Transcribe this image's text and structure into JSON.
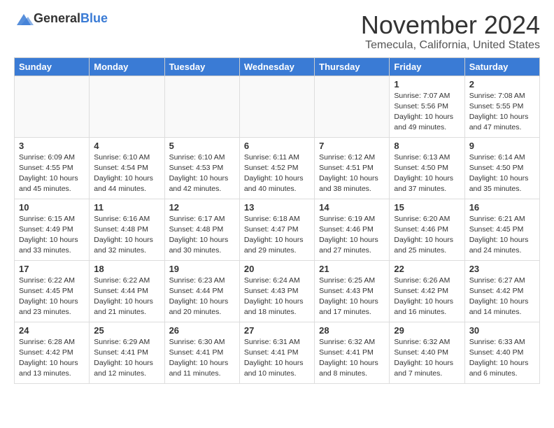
{
  "logo": {
    "general": "General",
    "blue": "Blue"
  },
  "header": {
    "month": "November 2024",
    "location": "Temecula, California, United States"
  },
  "weekdays": [
    "Sunday",
    "Monday",
    "Tuesday",
    "Wednesday",
    "Thursday",
    "Friday",
    "Saturday"
  ],
  "weeks": [
    [
      {
        "day": "",
        "info": ""
      },
      {
        "day": "",
        "info": ""
      },
      {
        "day": "",
        "info": ""
      },
      {
        "day": "",
        "info": ""
      },
      {
        "day": "",
        "info": ""
      },
      {
        "day": "1",
        "info": "Sunrise: 7:07 AM\nSunset: 5:56 PM\nDaylight: 10 hours and 49 minutes."
      },
      {
        "day": "2",
        "info": "Sunrise: 7:08 AM\nSunset: 5:55 PM\nDaylight: 10 hours and 47 minutes."
      }
    ],
    [
      {
        "day": "3",
        "info": "Sunrise: 6:09 AM\nSunset: 4:55 PM\nDaylight: 10 hours and 45 minutes."
      },
      {
        "day": "4",
        "info": "Sunrise: 6:10 AM\nSunset: 4:54 PM\nDaylight: 10 hours and 44 minutes."
      },
      {
        "day": "5",
        "info": "Sunrise: 6:10 AM\nSunset: 4:53 PM\nDaylight: 10 hours and 42 minutes."
      },
      {
        "day": "6",
        "info": "Sunrise: 6:11 AM\nSunset: 4:52 PM\nDaylight: 10 hours and 40 minutes."
      },
      {
        "day": "7",
        "info": "Sunrise: 6:12 AM\nSunset: 4:51 PM\nDaylight: 10 hours and 38 minutes."
      },
      {
        "day": "8",
        "info": "Sunrise: 6:13 AM\nSunset: 4:50 PM\nDaylight: 10 hours and 37 minutes."
      },
      {
        "day": "9",
        "info": "Sunrise: 6:14 AM\nSunset: 4:50 PM\nDaylight: 10 hours and 35 minutes."
      }
    ],
    [
      {
        "day": "10",
        "info": "Sunrise: 6:15 AM\nSunset: 4:49 PM\nDaylight: 10 hours and 33 minutes."
      },
      {
        "day": "11",
        "info": "Sunrise: 6:16 AM\nSunset: 4:48 PM\nDaylight: 10 hours and 32 minutes."
      },
      {
        "day": "12",
        "info": "Sunrise: 6:17 AM\nSunset: 4:48 PM\nDaylight: 10 hours and 30 minutes."
      },
      {
        "day": "13",
        "info": "Sunrise: 6:18 AM\nSunset: 4:47 PM\nDaylight: 10 hours and 29 minutes."
      },
      {
        "day": "14",
        "info": "Sunrise: 6:19 AM\nSunset: 4:46 PM\nDaylight: 10 hours and 27 minutes."
      },
      {
        "day": "15",
        "info": "Sunrise: 6:20 AM\nSunset: 4:46 PM\nDaylight: 10 hours and 25 minutes."
      },
      {
        "day": "16",
        "info": "Sunrise: 6:21 AM\nSunset: 4:45 PM\nDaylight: 10 hours and 24 minutes."
      }
    ],
    [
      {
        "day": "17",
        "info": "Sunrise: 6:22 AM\nSunset: 4:45 PM\nDaylight: 10 hours and 23 minutes."
      },
      {
        "day": "18",
        "info": "Sunrise: 6:22 AM\nSunset: 4:44 PM\nDaylight: 10 hours and 21 minutes."
      },
      {
        "day": "19",
        "info": "Sunrise: 6:23 AM\nSunset: 4:44 PM\nDaylight: 10 hours and 20 minutes."
      },
      {
        "day": "20",
        "info": "Sunrise: 6:24 AM\nSunset: 4:43 PM\nDaylight: 10 hours and 18 minutes."
      },
      {
        "day": "21",
        "info": "Sunrise: 6:25 AM\nSunset: 4:43 PM\nDaylight: 10 hours and 17 minutes."
      },
      {
        "day": "22",
        "info": "Sunrise: 6:26 AM\nSunset: 4:42 PM\nDaylight: 10 hours and 16 minutes."
      },
      {
        "day": "23",
        "info": "Sunrise: 6:27 AM\nSunset: 4:42 PM\nDaylight: 10 hours and 14 minutes."
      }
    ],
    [
      {
        "day": "24",
        "info": "Sunrise: 6:28 AM\nSunset: 4:42 PM\nDaylight: 10 hours and 13 minutes."
      },
      {
        "day": "25",
        "info": "Sunrise: 6:29 AM\nSunset: 4:41 PM\nDaylight: 10 hours and 12 minutes."
      },
      {
        "day": "26",
        "info": "Sunrise: 6:30 AM\nSunset: 4:41 PM\nDaylight: 10 hours and 11 minutes."
      },
      {
        "day": "27",
        "info": "Sunrise: 6:31 AM\nSunset: 4:41 PM\nDaylight: 10 hours and 10 minutes."
      },
      {
        "day": "28",
        "info": "Sunrise: 6:32 AM\nSunset: 4:41 PM\nDaylight: 10 hours and 8 minutes."
      },
      {
        "day": "29",
        "info": "Sunrise: 6:32 AM\nSunset: 4:40 PM\nDaylight: 10 hours and 7 minutes."
      },
      {
        "day": "30",
        "info": "Sunrise: 6:33 AM\nSunset: 4:40 PM\nDaylight: 10 hours and 6 minutes."
      }
    ]
  ]
}
